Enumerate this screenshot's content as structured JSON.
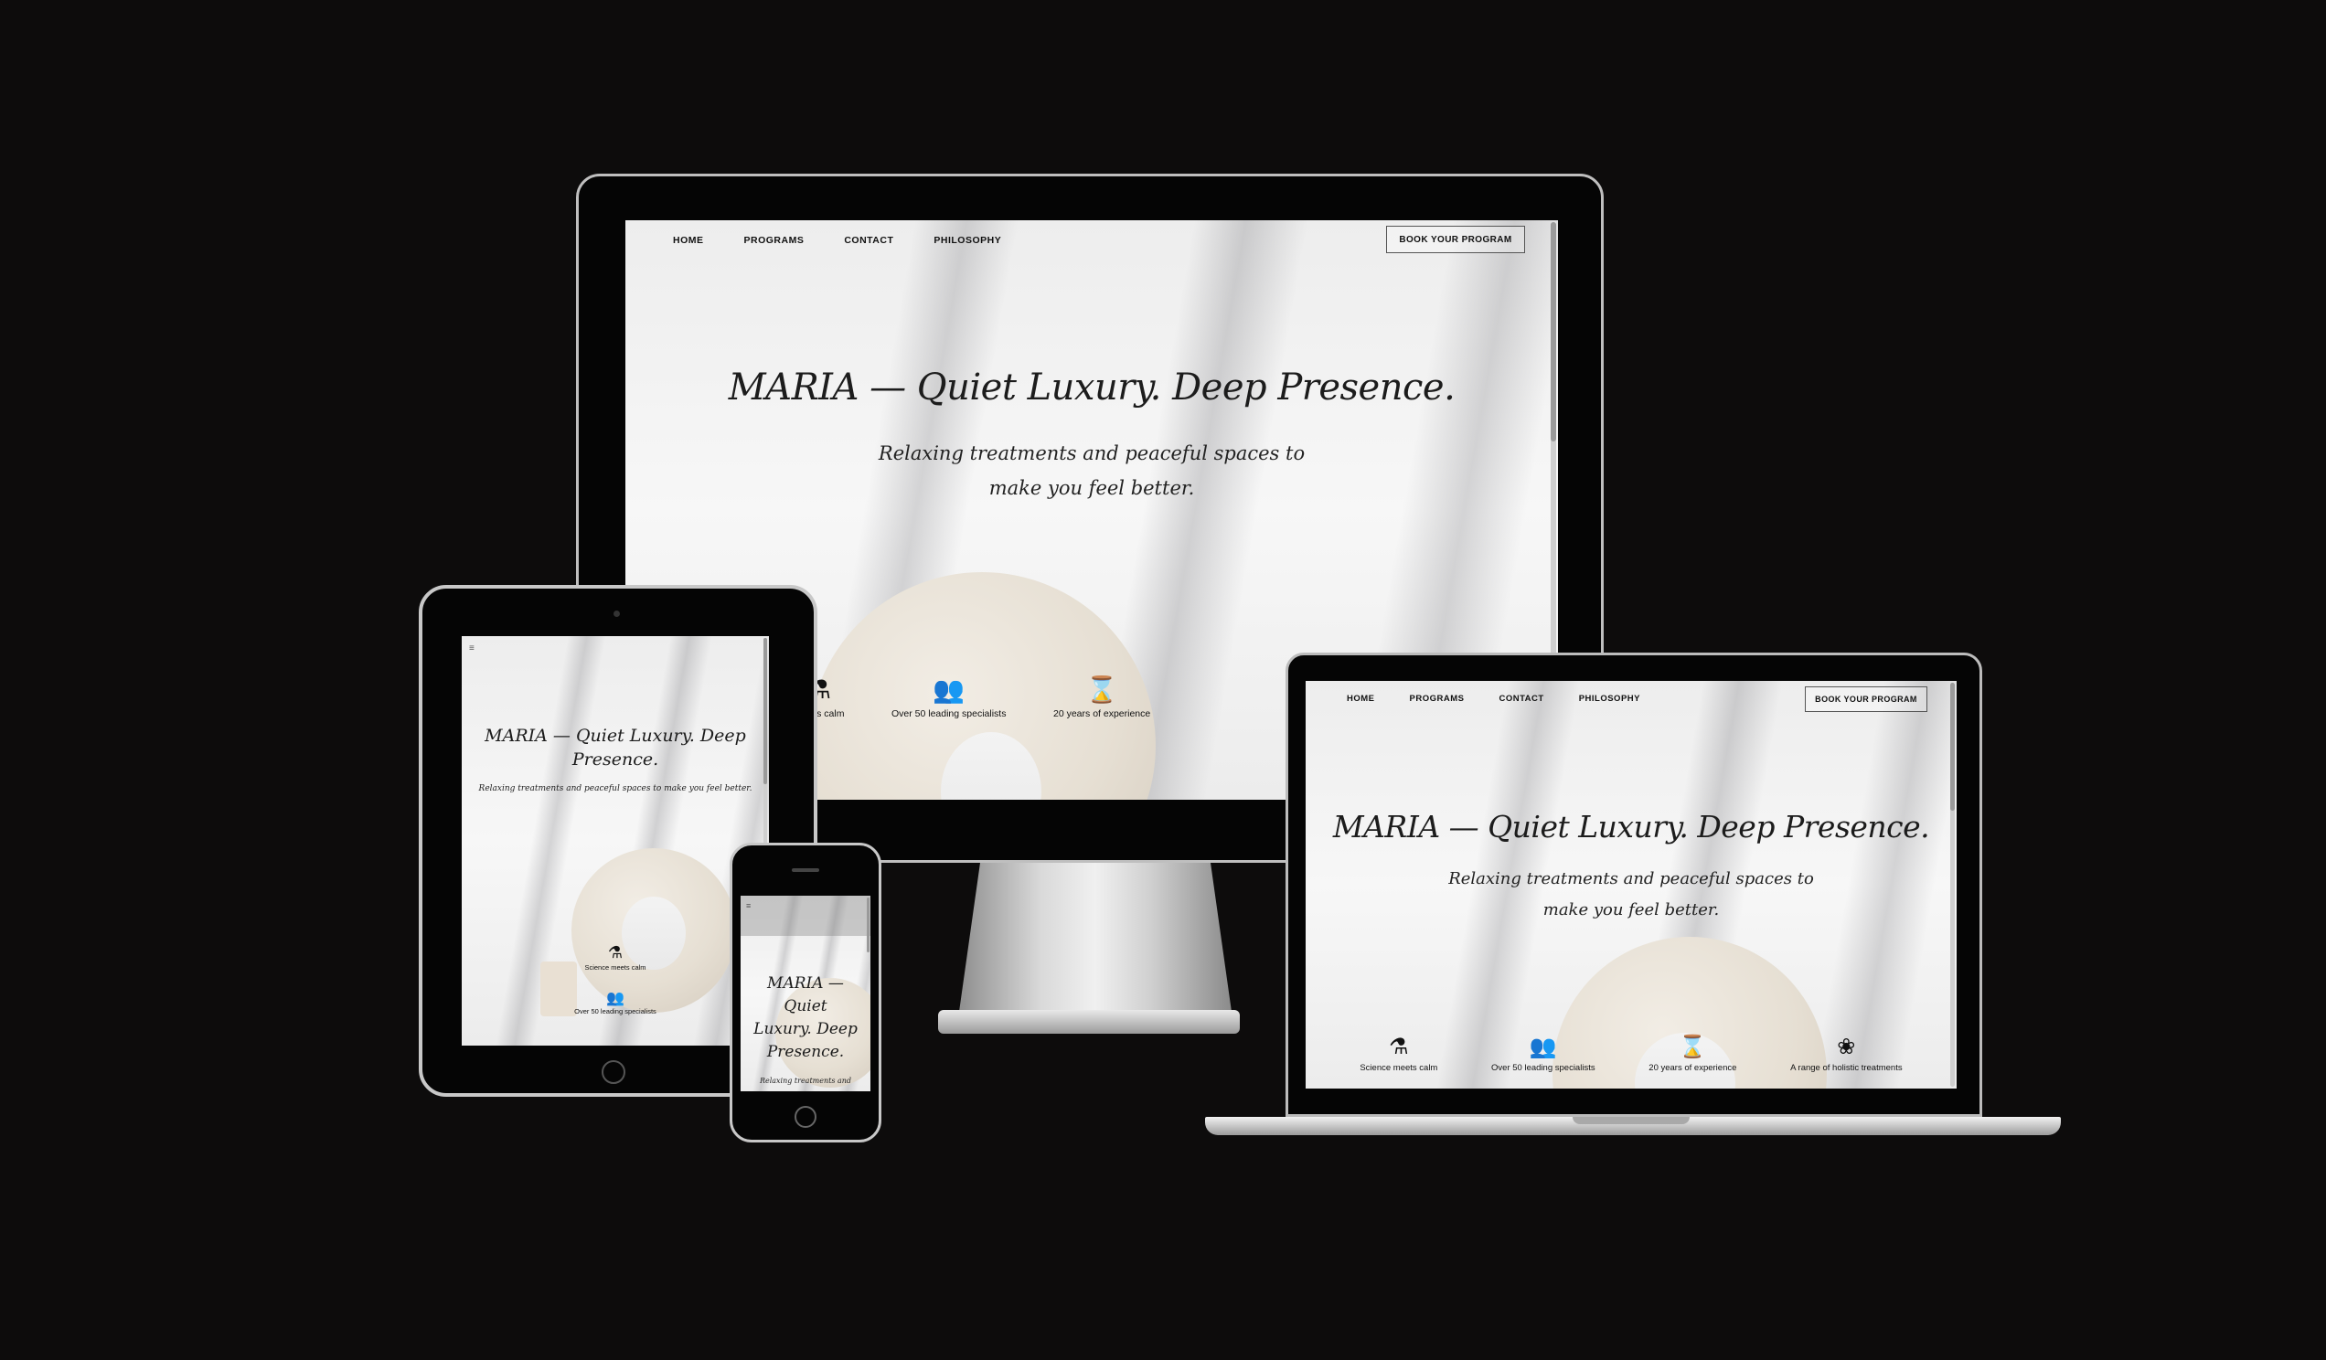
{
  "nav": {
    "home": "HOME",
    "programs": "PROGRAMS",
    "contact": "CONTACT",
    "philosophy": "PHILOSOPHY",
    "book": "BOOK YOUR PROGRAM",
    "menu_icon": "hamburger-icon"
  },
  "hero": {
    "title": "MARIA — Quiet Luxury. Deep Presence.",
    "title_tablet_1": "MARIA — Quiet Luxury. Deep",
    "title_tablet_2": "Presence.",
    "title_phone_1": "MARIA —",
    "title_phone_2": "Quiet",
    "title_phone_3": "Luxury. Deep",
    "title_phone_4": "Presence.",
    "subtitle_line1": "Relaxing treatments and peaceful spaces to",
    "subtitle_line2": "make you feel better.",
    "subtitle_full": "Relaxing treatments and peaceful spaces to make you feel better.",
    "subtitle_phone_partial": "Relaxing treatments and"
  },
  "features": [
    {
      "icon": "flask-icon",
      "glyph": "⚗",
      "label": "Science meets calm"
    },
    {
      "icon": "people-icon",
      "glyph": "👥",
      "label": "Over 50 leading specialists"
    },
    {
      "icon": "hourglass-icon",
      "glyph": "⌛",
      "label": "20 years of experience"
    },
    {
      "icon": "lotus-icon",
      "glyph": "❀",
      "label": "A range of holistic treatments"
    }
  ],
  "desktop_partial_feature_1": "meets calm",
  "colors": {
    "background": "#0d0c0c",
    "screen": "#f2f2f2",
    "text": "#1c1c1c",
    "vase": "#e6dfd3"
  }
}
